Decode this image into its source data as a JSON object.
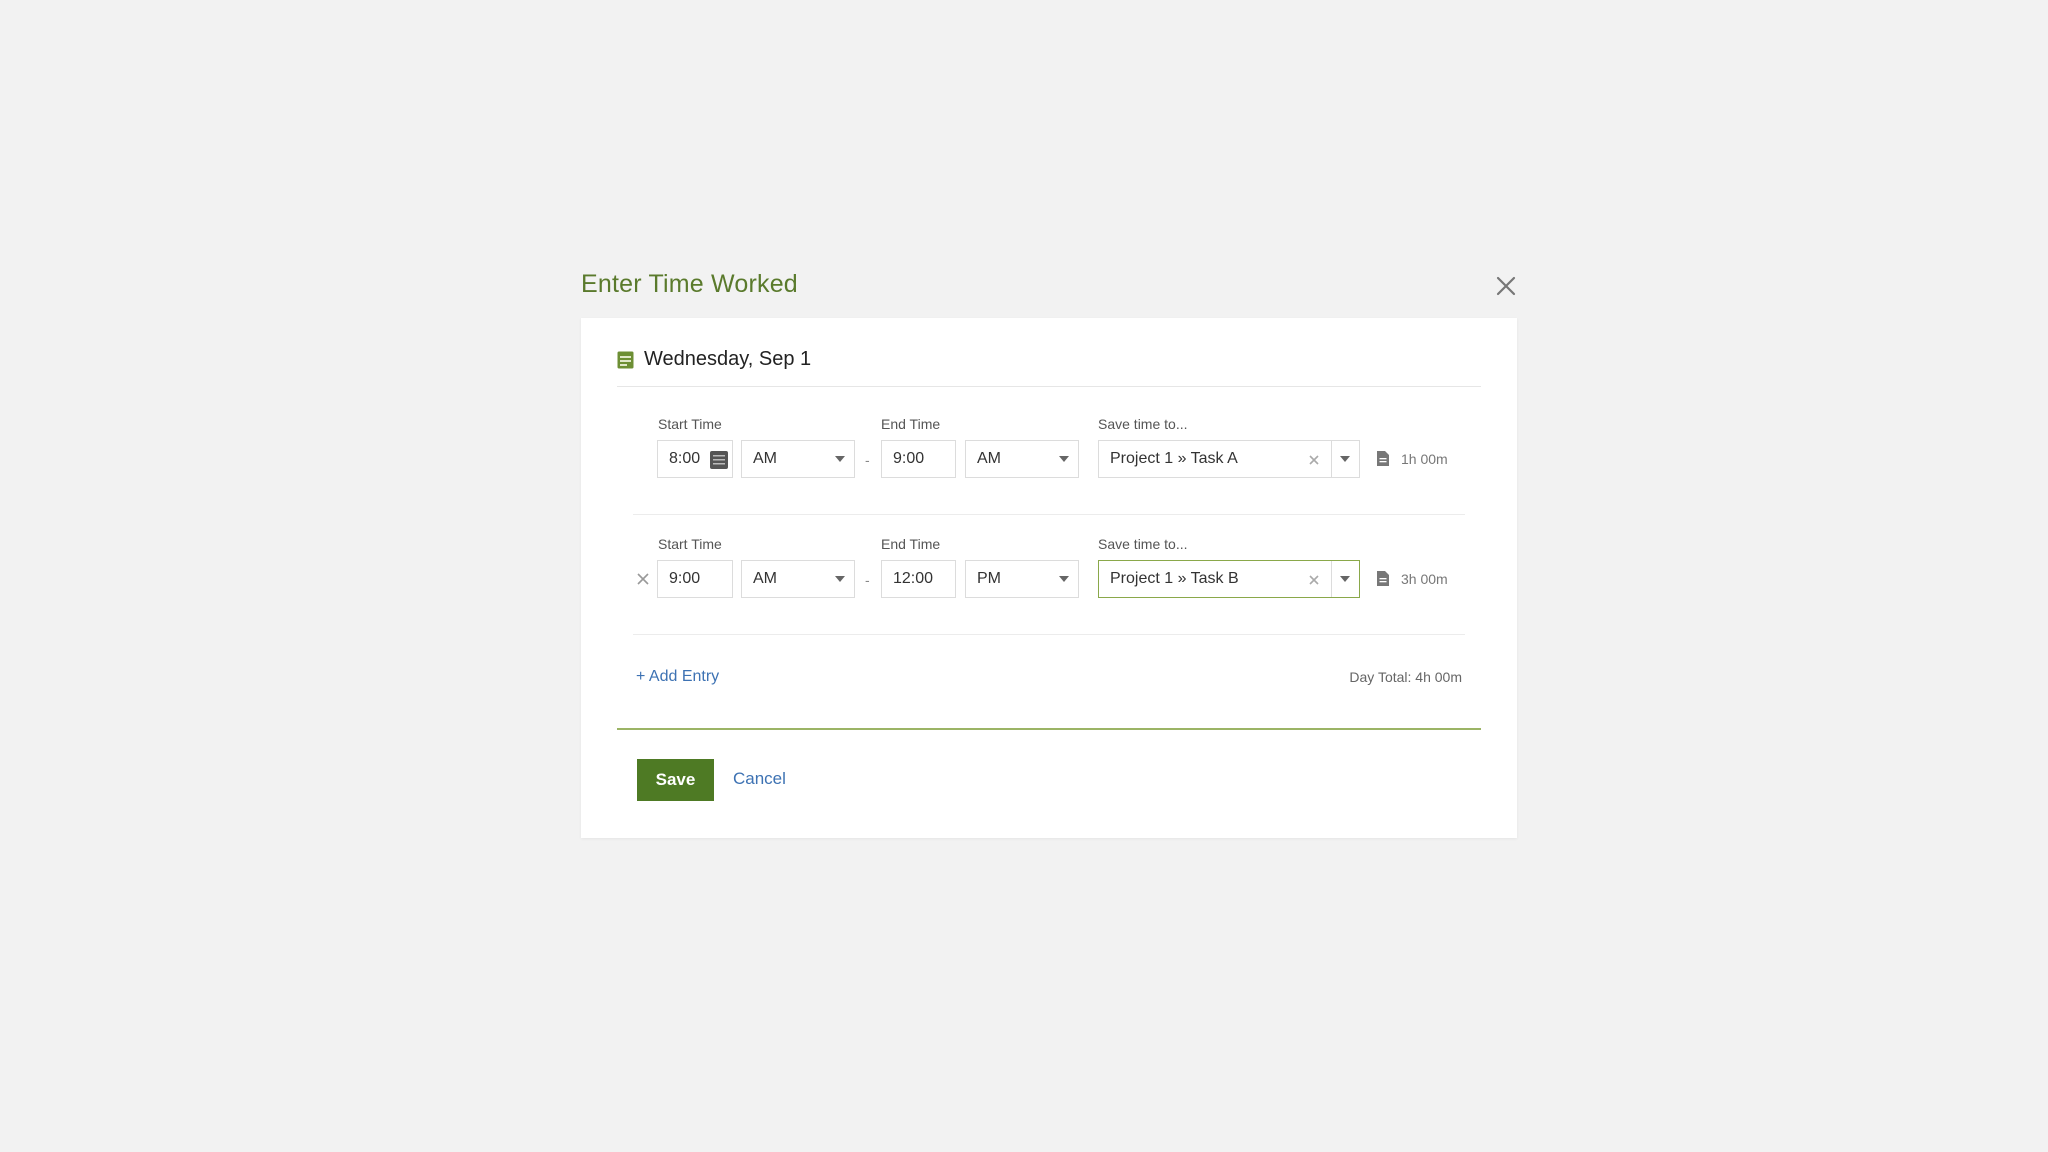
{
  "modal": {
    "title": "Enter Time Worked"
  },
  "day": {
    "title": "Wednesday, Sep 1"
  },
  "entries": [
    {
      "start_label": "Start Time",
      "start_value": "8:00",
      "start_ampm": "AM",
      "end_label": "End Time",
      "end_value": "9:00",
      "end_ampm": "AM",
      "save_label": "Save time to...",
      "project": "Project 1 » Task A",
      "duration": "1h 00m"
    },
    {
      "start_label": "Start Time",
      "start_value": "9:00",
      "start_ampm": "AM",
      "end_label": "End Time",
      "end_value": "12:00",
      "end_ampm": "PM",
      "save_label": "Save time to...",
      "project": "Project 1 » Task B",
      "duration": "3h 00m"
    }
  ],
  "separator": "-",
  "footer": {
    "add_entry": "+ Add Entry",
    "day_total": "Day Total: 4h 00m",
    "save": "Save",
    "cancel": "Cancel"
  },
  "colors": {
    "accent": "#5a7a2c",
    "save_bg": "#4e7a24",
    "link": "#3d72b3",
    "page_bg": "#f2f2f2"
  },
  "icons": [
    "close-icon",
    "calendar-icon",
    "clock-icon",
    "clear-icon",
    "chevron-down-icon",
    "document-icon",
    "remove-icon"
  ]
}
